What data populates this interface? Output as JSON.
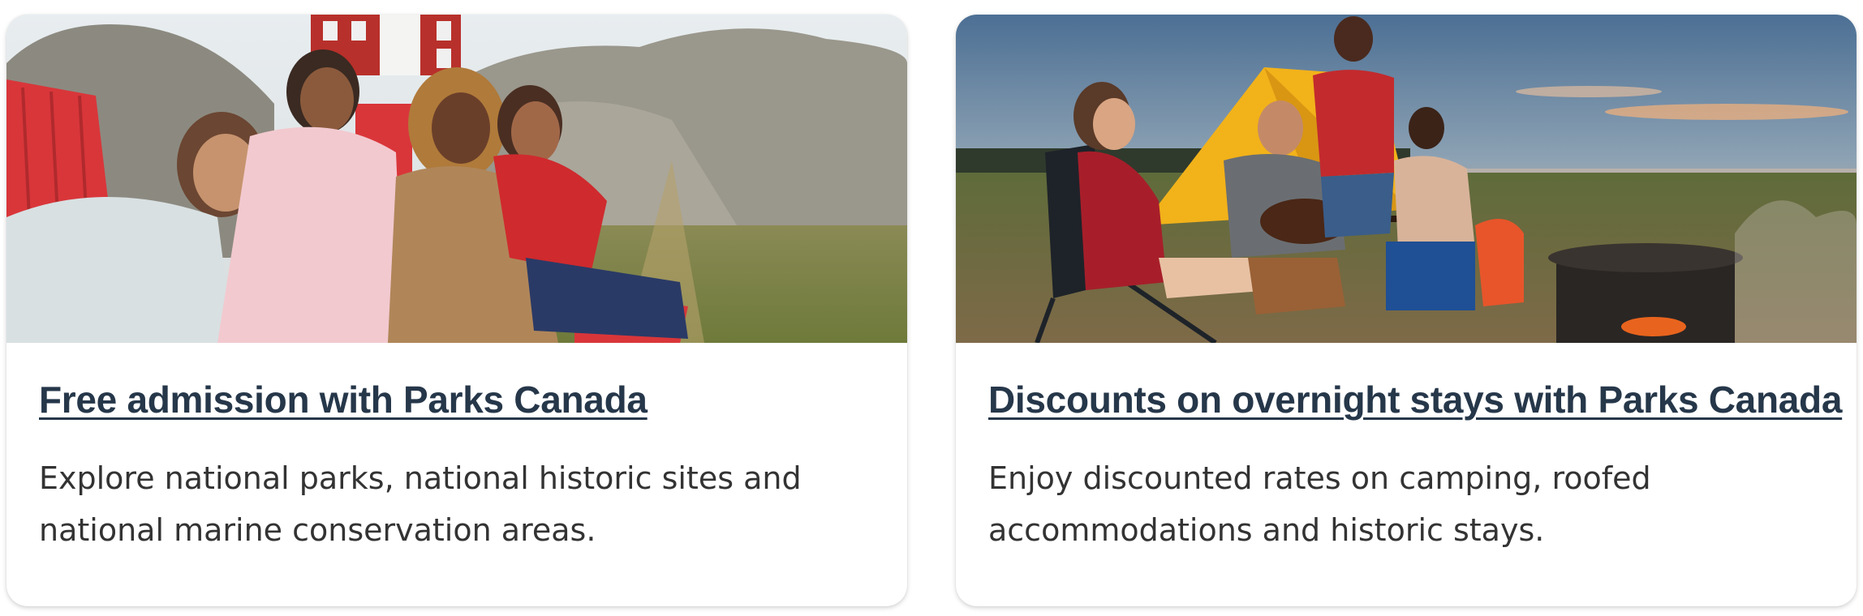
{
  "cards": [
    {
      "title": "Free admission with Parks Canada",
      "description": "Explore national parks, national historic sites and national marine conservation areas.",
      "image_subject": "family-on-red-adirondack-chairs"
    },
    {
      "title": "Discounts on overnight stays with Parks Canada",
      "description": "Enjoy discounted rates on camping, roofed accommodations and historic stays.",
      "image_subject": "campsite-at-sunset"
    }
  ],
  "colors": {
    "title": "#26374a",
    "text": "#333333",
    "card_background": "#ffffff"
  }
}
